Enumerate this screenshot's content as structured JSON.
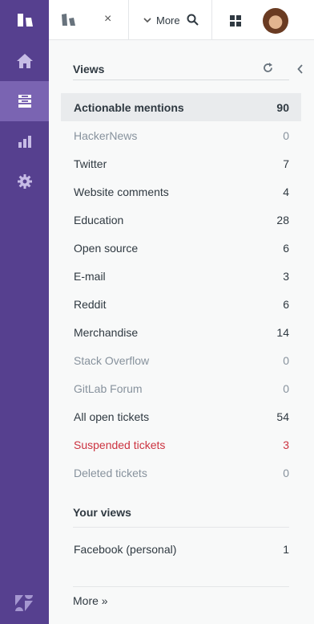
{
  "rail": {
    "items": [
      {
        "name": "home",
        "icon": "home-icon"
      },
      {
        "name": "views",
        "icon": "views-icon",
        "active": true
      },
      {
        "name": "reporting",
        "icon": "reporting-icon"
      },
      {
        "name": "admin",
        "icon": "gear-icon"
      }
    ],
    "accent": "#56408f",
    "active_color": "#7a64b2"
  },
  "topbar": {
    "tab_close": "×",
    "more_label": "More"
  },
  "views": {
    "title": "Views",
    "items": [
      {
        "label": "Actionable mentions",
        "count": "90",
        "state": "selected"
      },
      {
        "label": "HackerNews",
        "count": "0",
        "state": "muted"
      },
      {
        "label": "Twitter",
        "count": "7",
        "state": "normal"
      },
      {
        "label": "Website comments",
        "count": "4",
        "state": "normal"
      },
      {
        "label": "Education",
        "count": "28",
        "state": "normal"
      },
      {
        "label": "Open source",
        "count": "6",
        "state": "normal"
      },
      {
        "label": "E-mail",
        "count": "3",
        "state": "normal"
      },
      {
        "label": "Reddit",
        "count": "6",
        "state": "normal"
      },
      {
        "label": "Merchandise",
        "count": "14",
        "state": "normal"
      },
      {
        "label": "Stack Overflow",
        "count": "0",
        "state": "muted"
      },
      {
        "label": "GitLab Forum",
        "count": "0",
        "state": "muted"
      },
      {
        "label": "All open tickets",
        "count": "54",
        "state": "normal"
      },
      {
        "label": "Suspended tickets",
        "count": "3",
        "state": "alert"
      },
      {
        "label": "Deleted tickets",
        "count": "0",
        "state": "muted"
      }
    ]
  },
  "your_views": {
    "title": "Your views",
    "items": [
      {
        "label": "Facebook (personal)",
        "count": "1",
        "state": "normal"
      }
    ]
  },
  "more_link": "More »"
}
